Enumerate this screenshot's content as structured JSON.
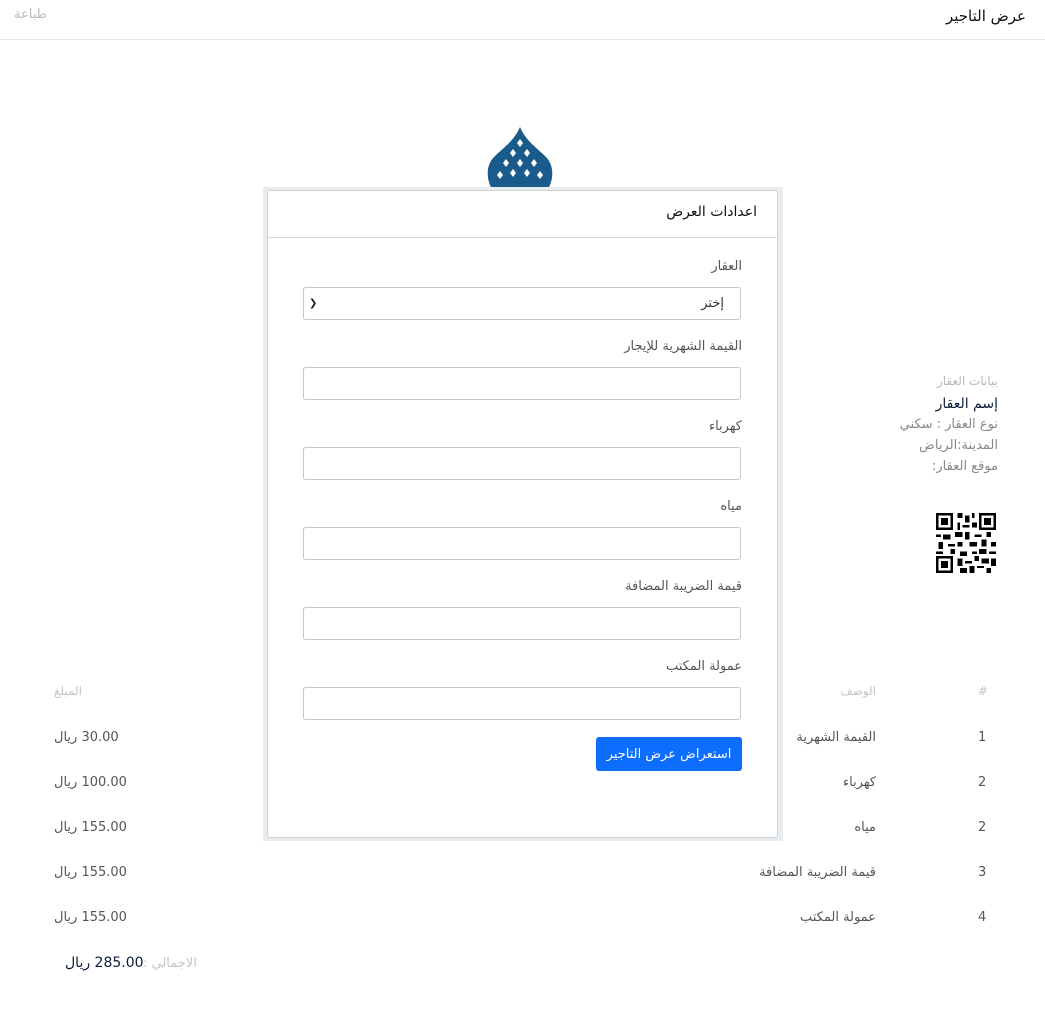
{
  "header": {
    "title": "عرض التاجير",
    "print_label": "طباعة"
  },
  "property": {
    "section_label": "بيانات العقار",
    "name": "إسم العقار",
    "type_line": "نوع العقار : سكني",
    "city_line": "المدينة:الرياض",
    "location_line": "موقع العقار:"
  },
  "table": {
    "headers": {
      "num": "#",
      "description": "الوصف",
      "amount": "المبلغ"
    },
    "rows": [
      {
        "num": "1",
        "description": "القيمة الشهرية",
        "amount": "30.00 ريال"
      },
      {
        "num": "2",
        "description": "كهرباء",
        "amount": "100.00 ريال"
      },
      {
        "num": "2",
        "description": "مياه",
        "amount": "155.00 ريال"
      },
      {
        "num": "3",
        "description": "قيمة الضريبة المضافة",
        "amount": "155.00 ريال"
      },
      {
        "num": "4",
        "description": "عمولة المكتب",
        "amount": "155.00 ريال"
      }
    ],
    "total_label": "الاجمالي :",
    "total_value": "285.00 ريال"
  },
  "modal": {
    "title": "اعدادات العرض",
    "property_label": "العقار",
    "property_selected": "إختر",
    "monthly_label": "القيمة الشهرية للإيجار",
    "monthly_value": "",
    "electricity_label": "كهرباء",
    "electricity_value": "",
    "water_label": "مياه",
    "water_value": "",
    "vat_label": "قيمة الضريبة المضافة",
    "vat_value": "",
    "commission_label": "عمولة المكتب",
    "commission_value": "",
    "submit_label": "استعراض عرض التاجير"
  },
  "colors": {
    "primary": "#0d6efd",
    "logo": "#1a5b8c",
    "dark_text": "#0d1b3e"
  }
}
